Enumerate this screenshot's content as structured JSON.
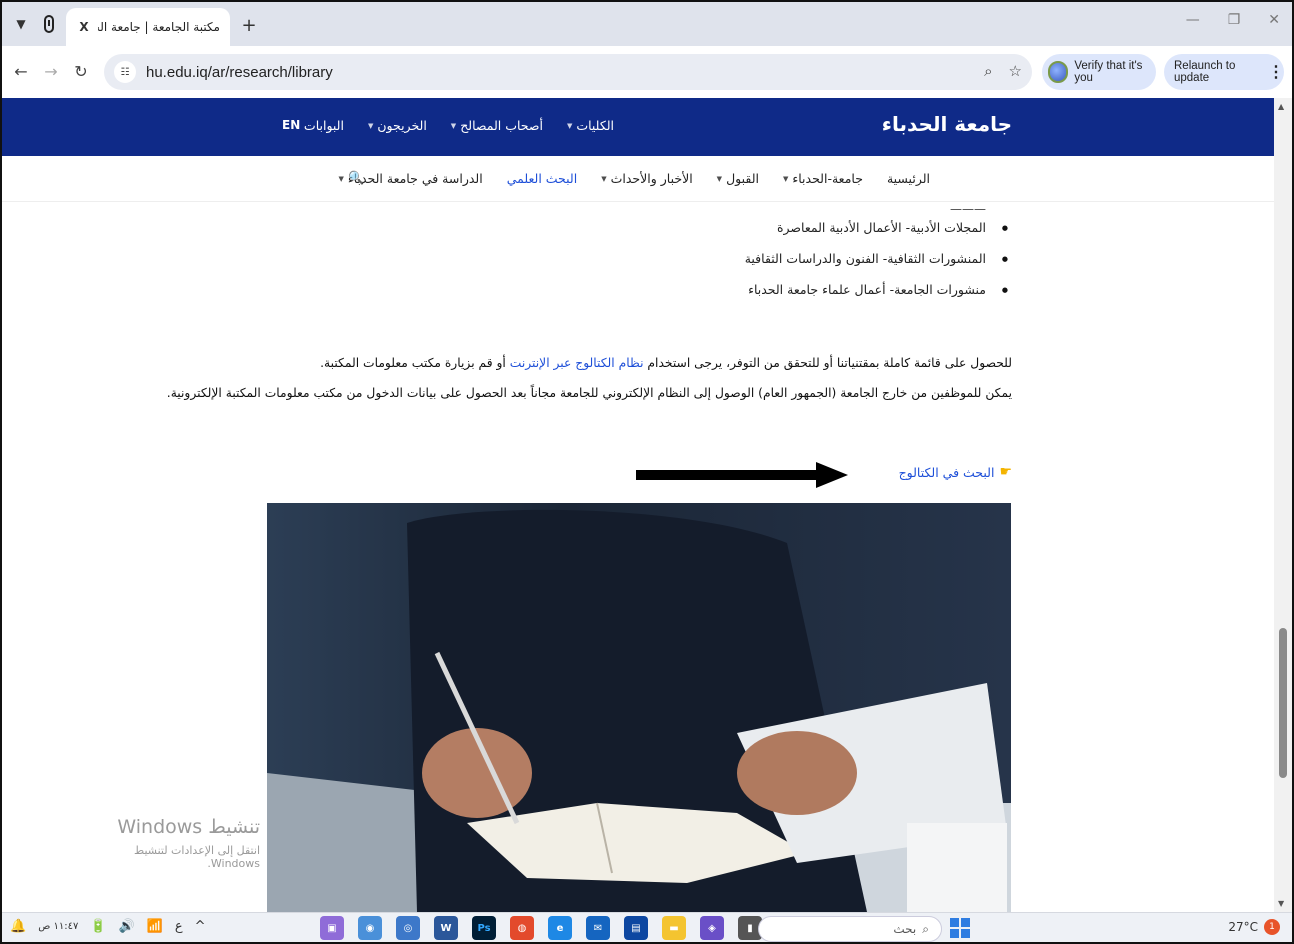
{
  "browser": {
    "tab_title": "مكتبة الجامعة | جامعة الحدباء",
    "tab_close": "X",
    "new_tab": "+",
    "url": "hu.edu.iq/ar/research/library",
    "verify_label": "Verify that it's you",
    "relaunch_label": "Relaunch to update"
  },
  "site": {
    "brand": "جامعة الحدباء",
    "top_nav": [
      {
        "label": "الكليات"
      },
      {
        "label": "أصحاب المصالح"
      },
      {
        "label": "الخريجون"
      },
      {
        "label": "البوابات"
      }
    ],
    "lang": "EN",
    "main_nav": [
      {
        "label": "الرئيسية"
      },
      {
        "label": "جامعة-الحدباء"
      },
      {
        "label": "القبول"
      },
      {
        "label": "الأخبار والأحداث"
      },
      {
        "label": "البحث العلمي"
      },
      {
        "label": "الدراسة في جامعة الحدباء"
      }
    ]
  },
  "content": {
    "bullets": [
      "المجلات الأدبية- الأعمال الأدبية المعاصرة",
      "المنشورات الثقافية- الفنون والدراسات الثقافية",
      "منشورات الجامعة- أعمال علماء جامعة الحدباء"
    ],
    "para1_before": "للحصول على قائمة كاملة بمقتنياتنا أو للتحقق من التوفر، يرجى استخدام ",
    "para1_link": "نظام الكتالوج عبر الإنترنت",
    "para1_after": " أو قم بزيارة مكتب معلومات المكتبة.",
    "para2": "يمكن للموظفين من خارج الجامعة (الجمهور العام) الوصول إلى النظام الإلكتروني للجامعة مجاناً بعد الحصول على بيانات الدخول من مكتب معلومات المكتبة الإلكترونية.",
    "catalog_link": "البحث في الكتالوج"
  },
  "watermark": {
    "title": "تنشيط Windows",
    "subtitle": "انتقل إلى الإعدادات لتنشيط Windows."
  },
  "taskbar": {
    "time": "١١:٤٧ ص",
    "search_placeholder": "بحث",
    "temperature": "27°C",
    "weather_badge": "1"
  }
}
